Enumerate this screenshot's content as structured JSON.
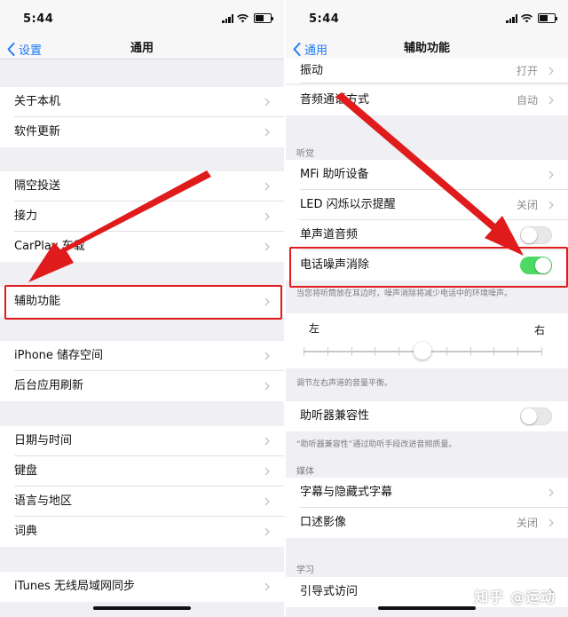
{
  "left": {
    "status": {
      "time": "5:44"
    },
    "nav": {
      "back": "设置",
      "title": "通用"
    },
    "items": [
      "关于本机",
      "软件更新",
      "隔空投送",
      "接力",
      "CarPlay 车载",
      "辅助功能",
      "iPhone 储存空间",
      "后台应用刷新",
      "日期与时间",
      "键盘",
      "语言与地区",
      "词典",
      "iTunes 无线局域网同步"
    ]
  },
  "right": {
    "status": {
      "time": "5:44"
    },
    "nav": {
      "back": "通用",
      "title": "辅助功能"
    },
    "vibration": {
      "label": "振动",
      "value": "打开"
    },
    "audio_route": {
      "label": "音频通话方式",
      "value": "自动"
    },
    "hearing_header": "听觉",
    "mfi": {
      "label": "MFi 助听设备"
    },
    "led": {
      "label": "LED 闪烁以示提醒",
      "value": "关闭"
    },
    "mono": {
      "label": "单声道音频",
      "on": false
    },
    "noise": {
      "label": "电话噪声消除",
      "on": true
    },
    "noise_note": "当您将听筒放在耳边时，噪声消除将减少电话中的环境噪声。",
    "balance": {
      "left": "左",
      "right": "右",
      "position": 0.5
    },
    "balance_note": "调节左右声道的音量平衡。",
    "hac": {
      "label": "助听器兼容性",
      "on": false
    },
    "hac_note": "“助听器兼容性”通过助听手段改进音频质量。",
    "media_header": "媒体",
    "subtitles": {
      "label": "字幕与隐藏式字幕"
    },
    "audio_desc": {
      "label": "口述影像",
      "value": "关闭"
    },
    "learning_header": "学习",
    "guided": {
      "label": "引导式访问"
    }
  },
  "watermark": "知乎 @运动",
  "colors": {
    "accent": "#1f7af5",
    "toggle_on": "#4cd964",
    "highlight": "#e01b1b"
  }
}
